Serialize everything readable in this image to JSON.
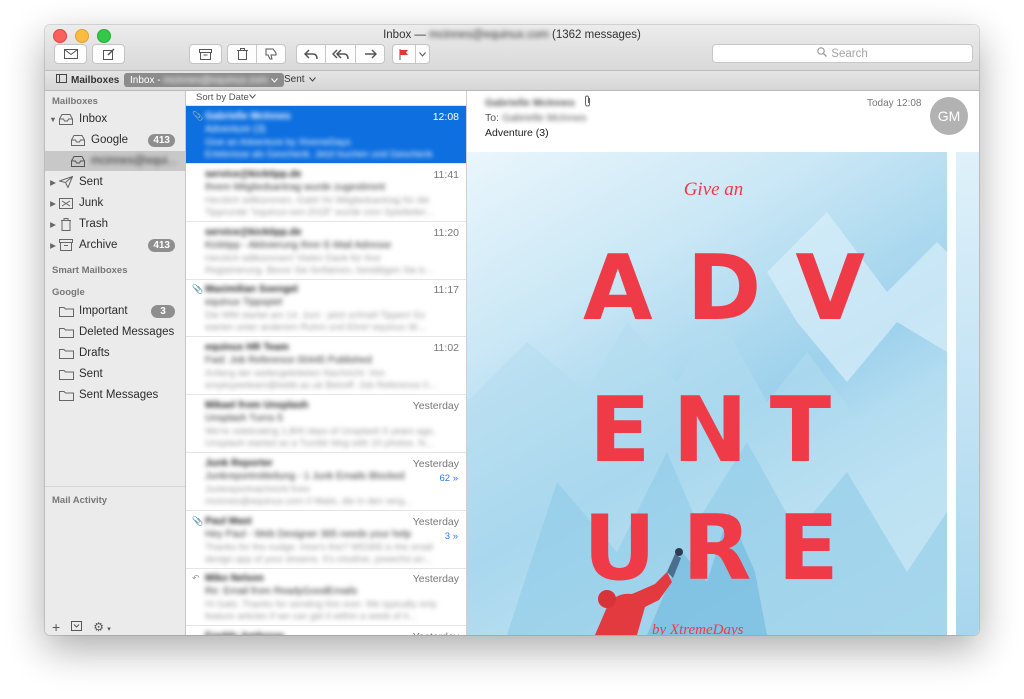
{
  "window": {
    "title_prefix": "Inbox —",
    "title_account": "mcinnes@equinux.com",
    "title_count": "(1362 messages)"
  },
  "toolbar": {
    "search_placeholder": "Search"
  },
  "favorites": {
    "mailboxes": "Mailboxes",
    "inbox_pill": "Inbox -",
    "inbox_account": "mcinnes@equinux.com",
    "sent": "Sent"
  },
  "sidebar": {
    "header_mailboxes": "Mailboxes",
    "inbox": "Inbox",
    "google": "Google",
    "google_count": "413",
    "account": "mcinnes@equi...",
    "sent": "Sent",
    "junk": "Junk",
    "trash": "Trash",
    "archive": "Archive",
    "archive_count": "413",
    "header_smart": "Smart Mailboxes",
    "header_google": "Google",
    "important": "Important",
    "important_count": "3",
    "deleted": "Deleted Messages",
    "drafts": "Drafts",
    "g_sent": "Sent",
    "sent_messages": "Sent Messages",
    "header_activity": "Mail Activity"
  },
  "list": {
    "sort_label": "Sort by Date",
    "messages": [
      {
        "from": "Gabrielle McInnes",
        "time": "12:08",
        "subject": "Adventure (3)",
        "p1": "Give an Adventure by XtremeDays",
        "p2": "Erlebnisse als Geschenk. Jetzt buchen und Geschenk",
        "mark": "clip"
      },
      {
        "from": "service@kicktipp.de",
        "time": "11:41",
        "subject": "Ihrem Mitgliedsantrag wurde zugestimmt",
        "p1": "Herzlich willkommen, Gabi! Ihr Mitgliedsantrag für die",
        "p2": "Tipprunde \"equinux-wm-2018\" wurde vom Spielleiter...",
        "mark": ""
      },
      {
        "from": "service@kicktipp.de",
        "time": "11:20",
        "subject": "Kicktipp - Aktivierung Ihrer E-Mail Adresse",
        "p1": "Herzlich willkommen! Vielen Dank für Ihre",
        "p2": "Registrierung. Bevor Sie fortfahren, bestätigen Sie b...",
        "mark": ""
      },
      {
        "from": "Maximilian Soengel",
        "time": "11:17",
        "subject": "equinux Tippspiel",
        "p1": "Die WM startet am 14. Juni - jetzt schnell Tippen! Es",
        "p2": "warten unter anderem Ruhm und Ehre! equinux W...",
        "mark": "clip"
      },
      {
        "from": "equinux HR Team",
        "time": "11:02",
        "subject": "Fwd: Job Reference 00445 Published",
        "p1": "Anfang der weitergeleiteten Nachricht: Von",
        "p2": "employeeteam@kebb.ac.uk Betreff: Job Reference 0...",
        "mark": ""
      },
      {
        "from": "Mikael from Unsplash",
        "time": "Yesterday",
        "subject": "Unsplash Turns 5",
        "p1": "We're celebrating 1,800 days of Unsplash 5 years ago,",
        "p2": "Unsplash started as a Tumblr blog with 10 photos. N...",
        "mark": ""
      },
      {
        "from": "Junk Reporter",
        "time": "Yesterday",
        "subject": "Junkreportmitteilung - 1 Junk Emails Blocked",
        "p1": "Junkreportnachricht from",
        "p2": "mcinnes@equinux.com 0 Mails, die in den verg...",
        "mark": "",
        "thread": "62 »"
      },
      {
        "from": "Paul Mast",
        "time": "Yesterday",
        "subject": "Hey Paul - Web Designer 365 needs your help",
        "p1": "Thanks for the nudge. How's this? WD365 is the small",
        "p2": "design app of your dreams. It's intuitive, powerful an...",
        "mark": "clip",
        "thread": "3 »"
      },
      {
        "from": "Miko Nelson",
        "time": "Yesterday",
        "subject": "Re: Email from ReadyGoodEmails",
        "p1": "Hi Gabi, Thanks for sending this over. We typically only",
        "p2": "feature articles if we can get it within a week of it...",
        "mark": "reply"
      },
      {
        "from": "Freddy Ambrose",
        "time": "Yesterday",
        "subject": "",
        "p1": "",
        "p2": "",
        "mark": ""
      }
    ]
  },
  "reader": {
    "from": "Gabrielle McInnes",
    "to_label": "To:",
    "to": "Gabrielle McInnes",
    "subject": "Adventure (3)",
    "date": "Today 12:08",
    "avatar_initials": "GM",
    "poster": {
      "give": "Give an",
      "line1": "ADV",
      "line2": "ENT",
      "line3": "URE",
      "byline": "by XtremeDays"
    }
  },
  "colors": {
    "selection": "#0e6fe0",
    "poster_red": "#ef3a47"
  }
}
